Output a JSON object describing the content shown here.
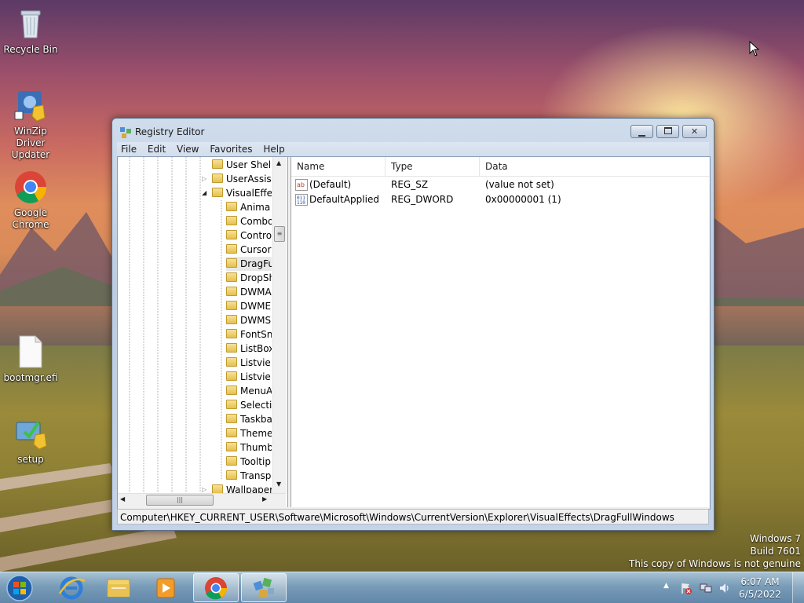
{
  "desktop": {
    "icons": [
      {
        "label": "Recycle Bin",
        "icon": "recycle-bin-icon"
      },
      {
        "label": "WinZip Driver Updater",
        "icon": "winzip-driver-updater-icon"
      },
      {
        "label": "Google Chrome",
        "icon": "chrome-icon"
      },
      {
        "label": "bootmgr.efi",
        "icon": "file-icon"
      },
      {
        "label": "setup",
        "icon": "setup-icon"
      }
    ]
  },
  "window": {
    "title": "Registry Editor",
    "controls": {
      "minimize": "minimize",
      "maximize": "maximize",
      "close": "close"
    },
    "menu": [
      "File",
      "Edit",
      "View",
      "Favorites",
      "Help"
    ],
    "tree": {
      "nodes": [
        {
          "label": "User Shell",
          "expander": ""
        },
        {
          "label": "UserAssist",
          "expander": "collapsed"
        },
        {
          "label": "VisualEffec",
          "expander": "expanded"
        },
        {
          "label": "Anima",
          "expander": ""
        },
        {
          "label": "Combo",
          "expander": ""
        },
        {
          "label": "Contro",
          "expander": ""
        },
        {
          "label": "Cursor",
          "expander": ""
        },
        {
          "label": "DragFu",
          "expander": "",
          "selected": true
        },
        {
          "label": "DropSh",
          "expander": ""
        },
        {
          "label": "DWMA",
          "expander": ""
        },
        {
          "label": "DWME",
          "expander": ""
        },
        {
          "label": "DWMS",
          "expander": ""
        },
        {
          "label": "FontSn",
          "expander": ""
        },
        {
          "label": "ListBox",
          "expander": ""
        },
        {
          "label": "Listvie",
          "expander": ""
        },
        {
          "label": "Listvie",
          "expander": ""
        },
        {
          "label": "MenuA",
          "expander": ""
        },
        {
          "label": "Selecti",
          "expander": ""
        },
        {
          "label": "Taskba",
          "expander": ""
        },
        {
          "label": "Theme",
          "expander": ""
        },
        {
          "label": "Thumb",
          "expander": ""
        },
        {
          "label": "Tooltip",
          "expander": ""
        },
        {
          "label": "Transp",
          "expander": ""
        },
        {
          "label": "Wallpaper",
          "expander": "collapsed"
        }
      ]
    },
    "list": {
      "columns": [
        "Name",
        "Type",
        "Data"
      ],
      "rows": [
        {
          "name": "(Default)",
          "type": "REG_SZ",
          "data": "(value not set)",
          "icon": "string-value-icon"
        },
        {
          "name": "DefaultApplied",
          "type": "REG_DWORD",
          "data": "0x00000001 (1)",
          "icon": "binary-value-icon"
        }
      ]
    },
    "status": "Computer\\HKEY_CURRENT_USER\\Software\\Microsoft\\Windows\\CurrentVersion\\Explorer\\VisualEffects\\DragFullWindows"
  },
  "watermark": {
    "line1": "Windows 7",
    "line2": "Build 7601",
    "line3": "This copy of Windows is not genuine"
  },
  "taskbar": {
    "pinned": [
      {
        "icon": "start-orb-icon"
      },
      {
        "icon": "internet-explorer-icon"
      },
      {
        "icon": "file-explorer-icon"
      },
      {
        "icon": "media-player-icon"
      },
      {
        "icon": "chrome-icon"
      },
      {
        "icon": "regedit-icon",
        "active": true
      }
    ],
    "clock": {
      "time": "6:07 AM",
      "date": "6/5/2022"
    }
  }
}
